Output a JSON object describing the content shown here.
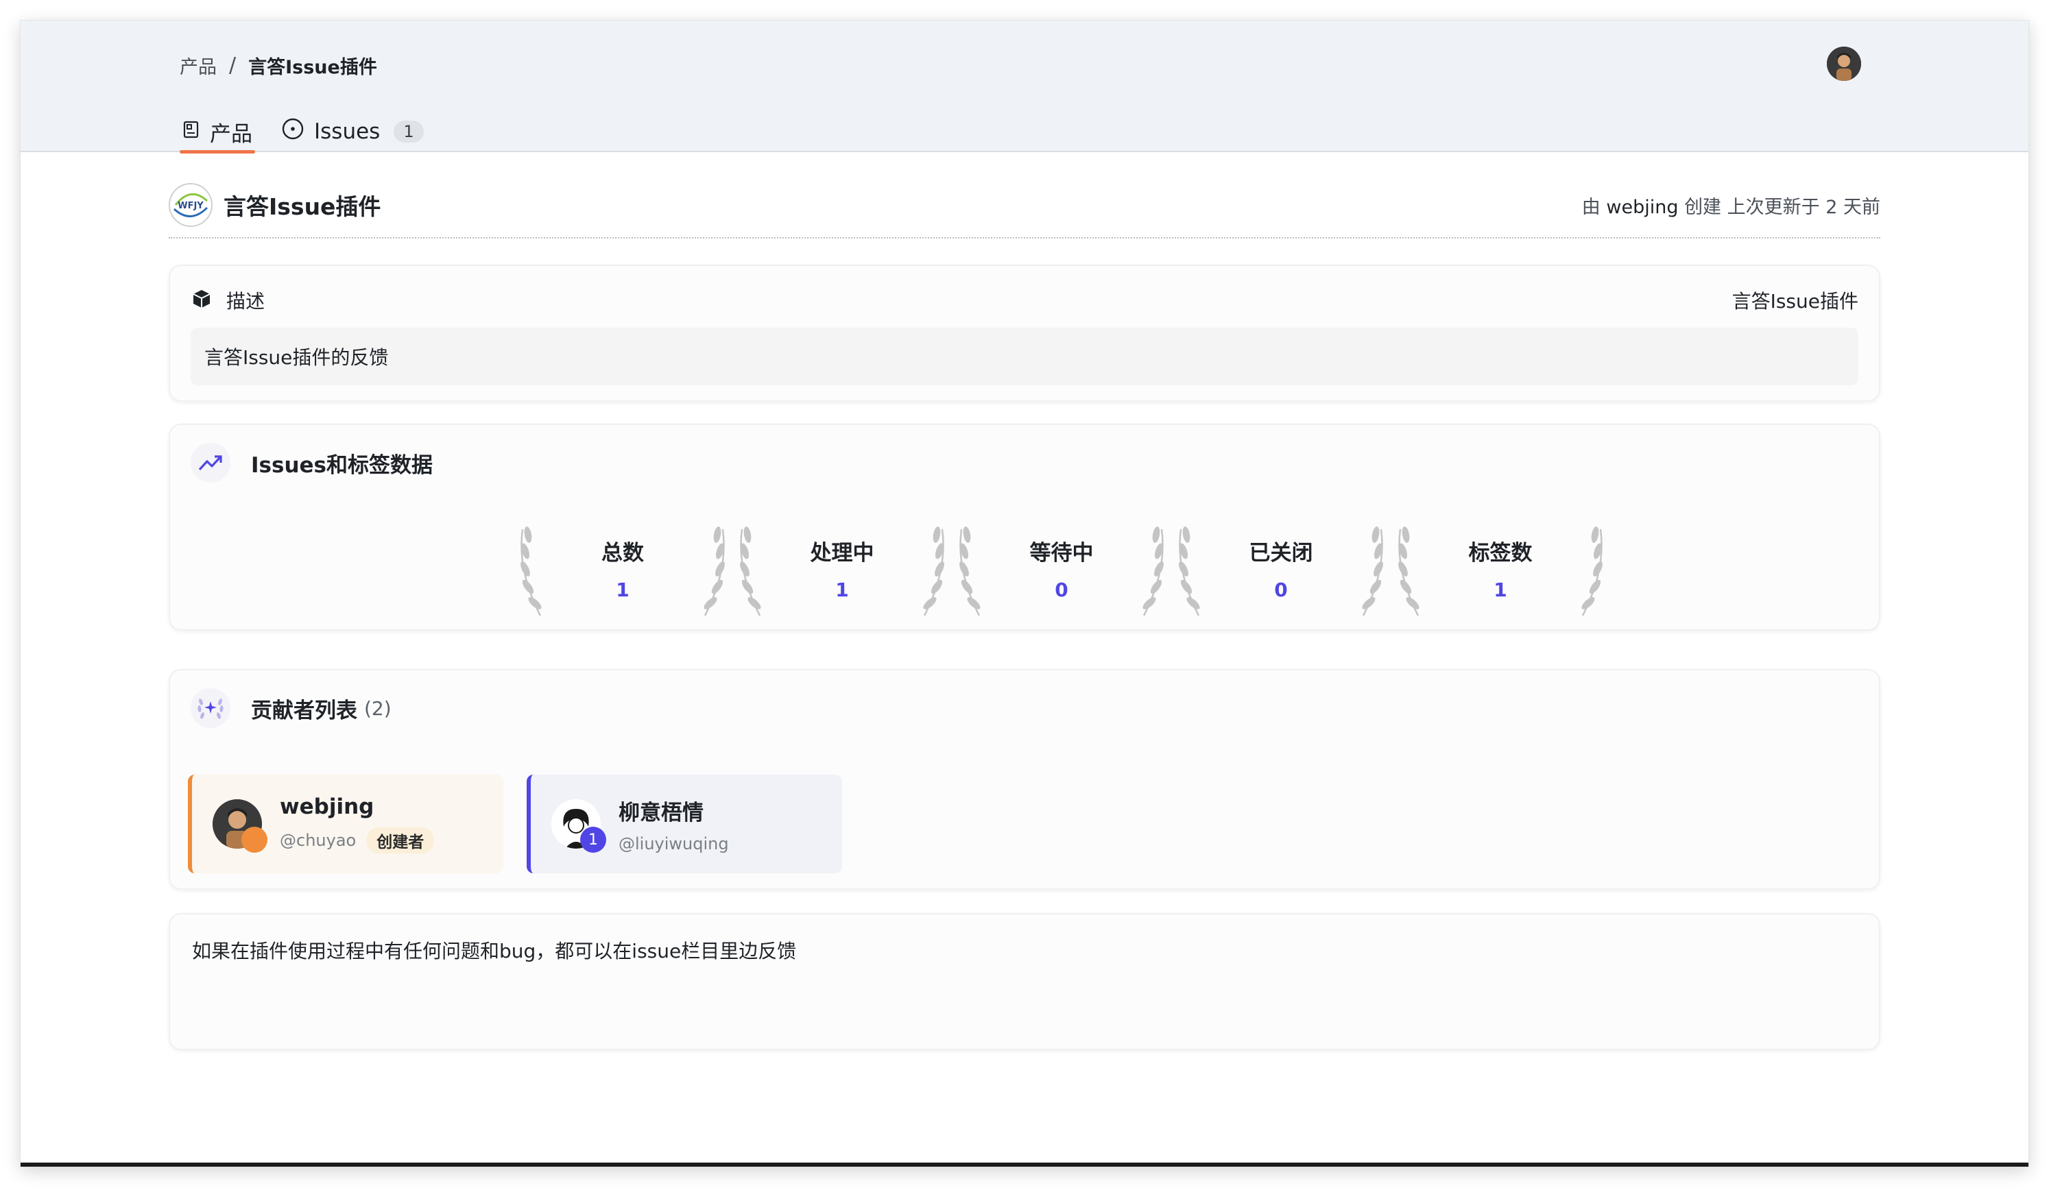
{
  "breadcrumb": {
    "root": "产品",
    "separator": "/",
    "current": "言答Issue插件"
  },
  "tabs": [
    {
      "label": "产品",
      "icon": "repo-icon",
      "active": true
    },
    {
      "label": "Issues",
      "icon": "issue-circle-icon",
      "count": "1"
    }
  ],
  "product": {
    "name": "言答Issue插件",
    "logo_text": "WFJY",
    "meta_prefix": "由",
    "author": "webjing",
    "meta_created": "创建",
    "meta_updated": "上次更新于 2 天前"
  },
  "description": {
    "title": "描述",
    "right_label": "言答Issue插件",
    "text": "言答Issue插件的反馈"
  },
  "stats": {
    "title": "Issues和标签数据",
    "items": [
      {
        "label": "总数",
        "value": "1"
      },
      {
        "label": "处理中",
        "value": "1"
      },
      {
        "label": "等待中",
        "value": "0"
      },
      {
        "label": "已关闭",
        "value": "0"
      },
      {
        "label": "标签数",
        "value": "1"
      }
    ],
    "accent": "#5046e5"
  },
  "contributors": {
    "title": "贡献者列表",
    "count": "(2)",
    "items": [
      {
        "name": "webjing",
        "handle": "@chuyao",
        "tag": "创建者",
        "badge": ""
      },
      {
        "name": "柳意梧情",
        "handle": "@liuyiwuqing",
        "tag": "",
        "badge": "1"
      }
    ]
  },
  "note": {
    "text": "如果在插件使用过程中有任何问题和bug，都可以在issue栏目里边反馈"
  },
  "colors": {
    "header_bg": "#eff3f8",
    "tab_underline": "#f0754a",
    "creator_accent": "#f08c3a",
    "member_accent": "#5046e5"
  }
}
